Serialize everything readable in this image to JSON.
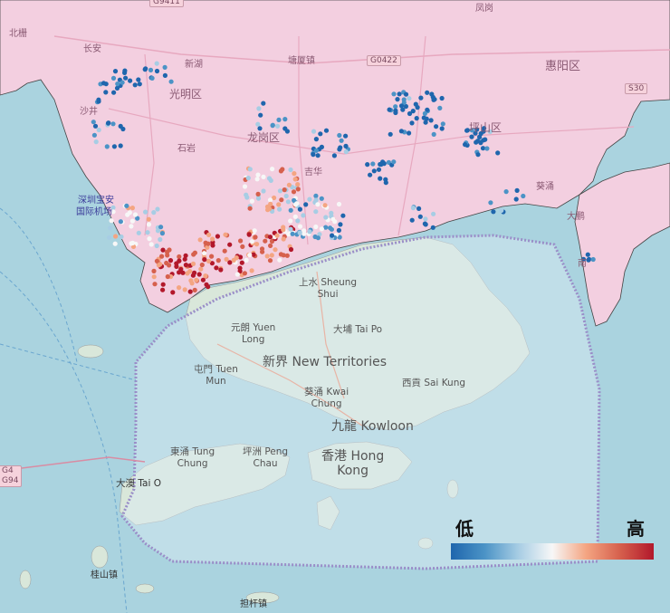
{
  "labels": {
    "beiwei": "北栅",
    "changan": "长安",
    "xinhu": "新湖",
    "tangxia": "塘厦镇",
    "g0422": "G0422",
    "g94_top": "G9411",
    "fengang": "凤岗",
    "huiyang": "惠阳区",
    "s30": "S30",
    "guangming": "光明区",
    "shajing": "沙井",
    "shiyan": "石岩",
    "longgang": "龙岗区",
    "pingshan": "坪山区",
    "airport1": "深圳宝安",
    "airport2": "国际机场",
    "jihua": "吉华",
    "kuichong": "葵涌",
    "dapeng": "大鹏",
    "nan": "南",
    "shang_shui": "上水 Sheung\nShui",
    "tai_po": "大埔 Tai Po",
    "yuen_long": "元朗 Yuen\nLong",
    "new_territories": "新界 New Territories",
    "tuen_mun": "屯門 Tuen\nMun",
    "sai_kung": "西貢 Sai Kung",
    "kwai_chung": "葵涌 Kwai\nChung",
    "kowloon": "九龍 Kowloon",
    "tung_chung": "東涌 Tung\nChung",
    "peng_chau": "坪洲 Peng\nChau",
    "hong_kong": "香港 Hong\nKong",
    "tai_o": "大澳 Tai O",
    "guishan": "桂山镇",
    "danggan": "担杆镇",
    "g4": "G4\nG94"
  },
  "legend": {
    "low": "低",
    "high": "高",
    "colors": [
      "#1f66ad",
      "#4b93c6",
      "#a7cde4",
      "#f7f7f7",
      "#f4a582",
      "#d6604d",
      "#b2182b"
    ]
  },
  "colors": {
    "sea": "#aad3df",
    "land_sz": "#f3cfe0",
    "land_hk": "#d7e8dc",
    "border": "#9a8ec8"
  }
}
